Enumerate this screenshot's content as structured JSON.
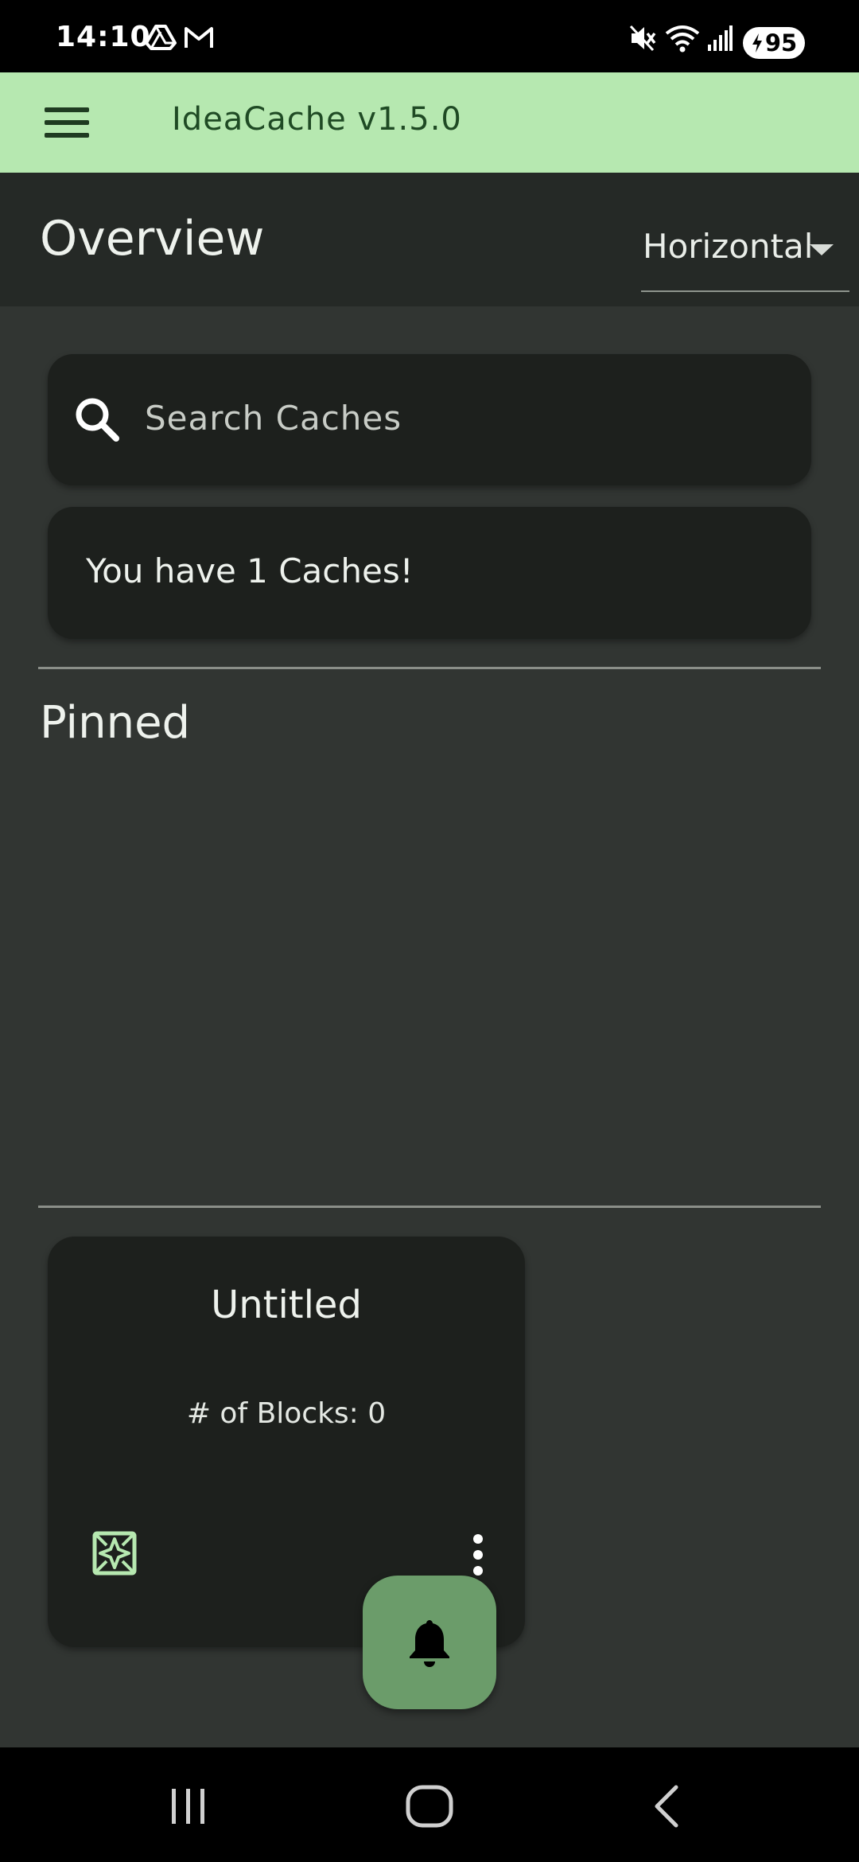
{
  "status_bar": {
    "time": "14:10",
    "battery_level": "95",
    "icons": [
      "drive-icon",
      "gmail-icon",
      "mute-icon",
      "wifi-icon",
      "signal-icon",
      "battery-charging-icon"
    ]
  },
  "app_bar": {
    "title": "IdeaCache v1.5.0",
    "background": "#b6e8b0"
  },
  "header": {
    "title": "Overview",
    "layout_select_value": "Horizontal"
  },
  "search": {
    "placeholder": "Search Caches"
  },
  "summary": {
    "text": "You have 1 Caches!"
  },
  "sections": {
    "pinned_label": "Pinned"
  },
  "caches": [
    {
      "title": "Untitled",
      "blocks_text": "# of Blocks: 0"
    }
  ],
  "fab": {
    "icon": "bell-icon",
    "color": "#6b9c6a"
  },
  "nav_bar": {
    "buttons": [
      "recents-icon",
      "home-icon",
      "back-icon"
    ]
  }
}
